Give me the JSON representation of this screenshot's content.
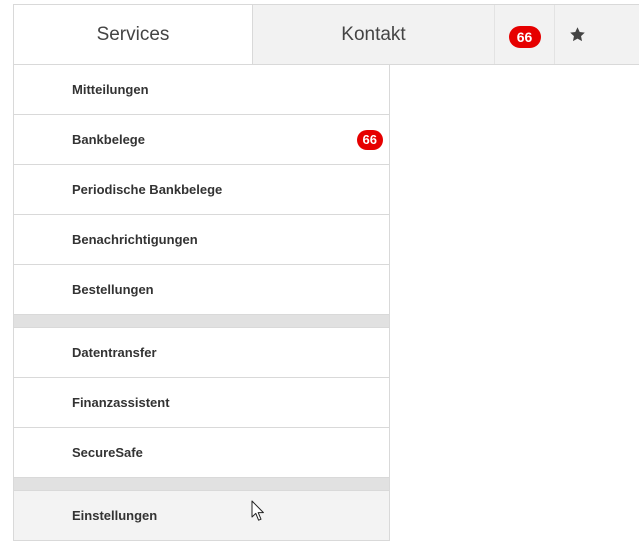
{
  "tabs": {
    "services_label": "Services",
    "kontakt_label": "Kontakt",
    "notifications_count": "66",
    "favorites_icon": "star-icon"
  },
  "menu": {
    "items": [
      {
        "label": "Mitteilungen"
      },
      {
        "label": "Bankbelege",
        "badge": "66"
      },
      {
        "label": "Periodische Bankbelege"
      },
      {
        "label": "Benachrichtigungen"
      },
      {
        "label": "Bestellungen"
      },
      {
        "label": "Datentransfer"
      },
      {
        "label": "Finanzassistent"
      },
      {
        "label": "SecureSafe"
      },
      {
        "label": "Einstellungen"
      }
    ]
  },
  "colors": {
    "badge": "#e60000",
    "tab_inactive": "#f2f2f2",
    "separator": "#e1e1e1",
    "border": "#d9d9d9"
  },
  "cursor_icon": "mouse-pointer-icon"
}
